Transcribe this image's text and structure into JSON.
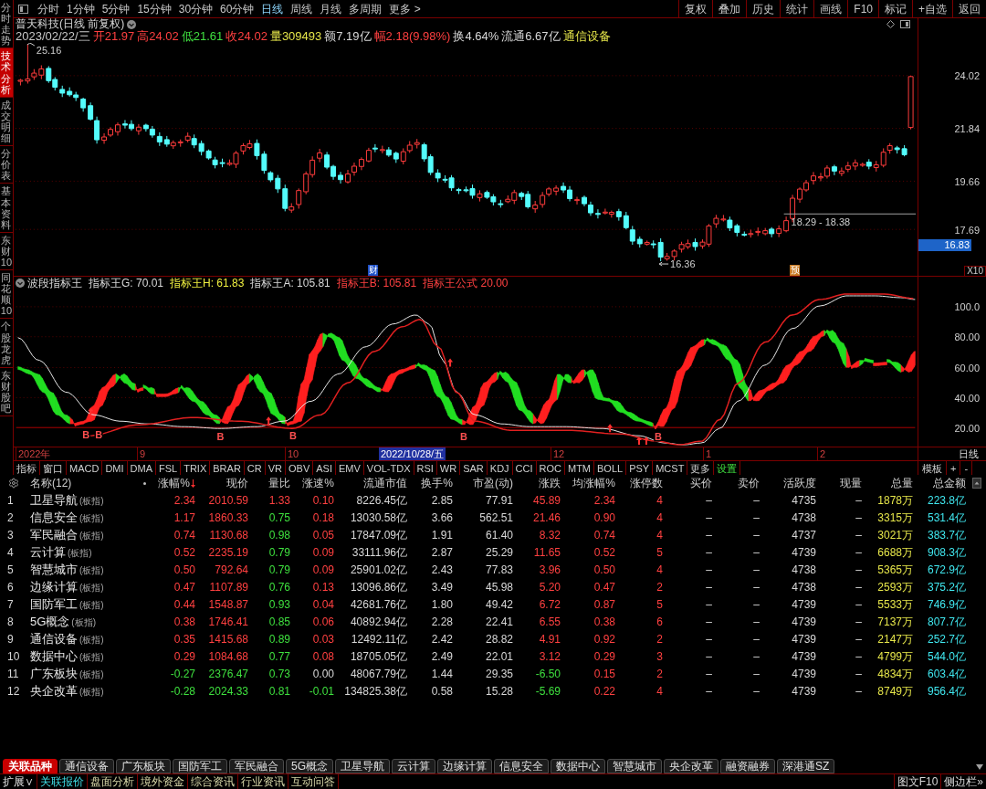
{
  "sidebar": {
    "tabs": [
      {
        "label": "分时走势",
        "selected": false
      },
      {
        "label": "技术分析",
        "selected": true
      },
      {
        "label": "成交明细",
        "selected": false
      },
      {
        "label": "分价表",
        "selected": false
      },
      {
        "label": "基本资料",
        "selected": false
      },
      {
        "label": "东财10",
        "selected": false
      },
      {
        "label": "同花顺10",
        "selected": false
      },
      {
        "label": "个股龙虎",
        "selected": false
      },
      {
        "label": "东财股吧",
        "selected": false
      }
    ]
  },
  "toolbar": {
    "periods": [
      {
        "label": "分时",
        "selected": false
      },
      {
        "label": "1分钟",
        "selected": false
      },
      {
        "label": "5分钟",
        "selected": false
      },
      {
        "label": "15分钟",
        "selected": false
      },
      {
        "label": "30分钟",
        "selected": false
      },
      {
        "label": "60分钟",
        "selected": false
      },
      {
        "label": "日线",
        "selected": true
      },
      {
        "label": "周线",
        "selected": false
      },
      {
        "label": "月线",
        "selected": false
      },
      {
        "label": "多周期",
        "selected": false
      },
      {
        "label": "更多 >",
        "selected": false
      }
    ],
    "actions": [
      "复权",
      "叠加",
      "历史",
      "统计",
      "画线",
      "F10",
      "标记",
      "+自选",
      "返回"
    ]
  },
  "price_chart": {
    "title": "普天科技(日线 前复权)",
    "date": "2023/02/22/三",
    "quote": [
      {
        "text": "开21.97",
        "color": "#ff4040"
      },
      {
        "text": "高24.02",
        "color": "#ff4040"
      },
      {
        "text": "低21.61",
        "color": "#40e040"
      },
      {
        "text": "收24.02",
        "color": "#ff4040"
      },
      {
        "text": "量309493",
        "color": "#e6e64a"
      },
      {
        "text": "额7.19亿",
        "color": "#d8d8d8"
      },
      {
        "text": "幅2.18(9.98%)",
        "color": "#ff4040"
      },
      {
        "text": "换4.64%",
        "color": "#d8d8d8"
      },
      {
        "text": "流通6.67亿",
        "color": "#d8d8d8"
      },
      {
        "text": "通信设备",
        "color": "#e6e64a"
      }
    ],
    "axis_labels": [
      "24.02",
      "21.84",
      "19.66",
      "17.69"
    ],
    "marker_price": "16.83",
    "scale": "X10",
    "high_label": "25.16",
    "low_label": "16.36",
    "range_label": "18.29 - 18.38",
    "events": [
      {
        "label": "财",
        "kind": "finance"
      },
      {
        "label": "预",
        "kind": "forecast"
      }
    ]
  },
  "indicator": {
    "name": "波段指标王",
    "values": [
      {
        "text": "指标王G: 70.01",
        "color": "#d8d8d8"
      },
      {
        "text": "指标王H: 61.83",
        "color": "#f0f040"
      },
      {
        "text": "指标王A: 105.81",
        "color": "#d8d8d8"
      },
      {
        "text": "指标王B: 105.81",
        "color": "#ff4040"
      },
      {
        "text": "指标王公式 20.00",
        "color": "#ff4040"
      }
    ],
    "axis_labels": [
      "100.0",
      "80.00",
      "60.00",
      "40.00",
      "20.00"
    ],
    "signals": [
      "B",
      "B",
      "B",
      "B",
      "B",
      "B"
    ]
  },
  "date_axis": {
    "ticks": [
      "2022年",
      "9",
      "10",
      "12",
      "1",
      "2"
    ],
    "cursor_date": "2022/10/28/五",
    "period": "日线"
  },
  "indicator_bar": {
    "items": [
      "指标",
      "窗口",
      "MACD",
      "DMI",
      "DMA",
      "FSL",
      "TRIX",
      "BRAR",
      "CR",
      "VR",
      "OBV",
      "ASI",
      "EMV",
      "VOL-TDX",
      "RSI",
      "WR",
      "SAR",
      "KDJ",
      "CCI",
      "ROC",
      "MTM",
      "BOLL",
      "PSY",
      "MCST",
      "更多"
    ],
    "settings": "设置",
    "tools": [
      "模板",
      "+",
      "-"
    ]
  },
  "table": {
    "name_header": "名称(12)",
    "columns": [
      {
        "label": "涨幅%",
        "sorted": true
      },
      {
        "label": "现价",
        "sorted": false
      },
      {
        "label": "量比",
        "sorted": false
      },
      {
        "label": "涨速%",
        "sorted": false
      },
      {
        "label": "流通市值",
        "sorted": false
      },
      {
        "label": "换手%",
        "sorted": false
      },
      {
        "label": "市盈(动)",
        "sorted": false
      },
      {
        "label": "涨跌",
        "sorted": false
      },
      {
        "label": "均涨幅%",
        "sorted": false
      },
      {
        "label": "涨停数",
        "sorted": false
      },
      {
        "label": "买价",
        "sorted": false
      },
      {
        "label": "卖价",
        "sorted": false
      },
      {
        "label": "活跃度",
        "sorted": false
      },
      {
        "label": "现量",
        "sorted": false
      },
      {
        "label": "总量",
        "sorted": false
      },
      {
        "label": "总金额",
        "sorted": false
      }
    ],
    "rows": [
      {
        "no": "1",
        "name": "卫星导航",
        "tag": "(板指)",
        "rising": true,
        "vol_ratio_high": true,
        "speed_rising": true,
        "speed_falling": false,
        "cells": [
          "2.34",
          "2010.59",
          "1.33",
          "0.10",
          "8226.45亿",
          "2.85",
          "77.91",
          "45.89",
          "2.34",
          "4",
          "–",
          "–",
          "4735",
          "–",
          "1878万",
          "223.8亿"
        ]
      },
      {
        "no": "2",
        "name": "信息安全",
        "tag": "(板指)",
        "rising": true,
        "vol_ratio_high": false,
        "speed_rising": true,
        "speed_falling": false,
        "cells": [
          "1.17",
          "1860.33",
          "0.75",
          "0.18",
          "13030.58亿",
          "3.66",
          "562.51",
          "21.46",
          "0.90",
          "4",
          "–",
          "–",
          "4738",
          "–",
          "3315万",
          "531.4亿"
        ]
      },
      {
        "no": "3",
        "name": "军民融合",
        "tag": "(板指)",
        "rising": true,
        "vol_ratio_high": false,
        "speed_rising": true,
        "speed_falling": false,
        "cells": [
          "0.74",
          "1130.68",
          "0.98",
          "0.05",
          "17847.09亿",
          "1.91",
          "61.40",
          "8.32",
          "0.74",
          "4",
          "–",
          "–",
          "4737",
          "–",
          "3021万",
          "383.7亿"
        ]
      },
      {
        "no": "4",
        "name": "云计算",
        "tag": "(板指)",
        "rising": true,
        "vol_ratio_high": false,
        "speed_rising": true,
        "speed_falling": false,
        "cells": [
          "0.52",
          "2235.19",
          "0.79",
          "0.09",
          "33111.96亿",
          "2.87",
          "25.29",
          "11.65",
          "0.52",
          "5",
          "–",
          "–",
          "4739",
          "–",
          "6688万",
          "908.3亿"
        ]
      },
      {
        "no": "5",
        "name": "智慧城市",
        "tag": "(板指)",
        "rising": true,
        "vol_ratio_high": false,
        "speed_rising": true,
        "speed_falling": false,
        "cells": [
          "0.50",
          "792.64",
          "0.79",
          "0.09",
          "25901.02亿",
          "2.43",
          "77.83",
          "3.96",
          "0.50",
          "4",
          "–",
          "–",
          "4738",
          "–",
          "5365万",
          "672.9亿"
        ]
      },
      {
        "no": "6",
        "name": "边缘计算",
        "tag": "(板指)",
        "rising": true,
        "vol_ratio_high": false,
        "speed_rising": true,
        "speed_falling": false,
        "cells": [
          "0.47",
          "1107.89",
          "0.76",
          "0.13",
          "13096.86亿",
          "3.49",
          "45.98",
          "5.20",
          "0.47",
          "2",
          "–",
          "–",
          "4738",
          "–",
          "2593万",
          "375.2亿"
        ]
      },
      {
        "no": "7",
        "name": "国防军工",
        "tag": "(板指)",
        "rising": true,
        "vol_ratio_high": false,
        "speed_rising": true,
        "speed_falling": false,
        "cells": [
          "0.44",
          "1548.87",
          "0.93",
          "0.04",
          "42681.76亿",
          "1.80",
          "49.42",
          "6.72",
          "0.87",
          "5",
          "–",
          "–",
          "4739",
          "–",
          "5533万",
          "746.9亿"
        ]
      },
      {
        "no": "8",
        "name": "5G概念",
        "tag": "(板指)",
        "rising": true,
        "vol_ratio_high": false,
        "speed_rising": true,
        "speed_falling": false,
        "cells": [
          "0.38",
          "1746.41",
          "0.85",
          "0.06",
          "40892.94亿",
          "2.28",
          "22.41",
          "6.55",
          "0.38",
          "6",
          "–",
          "–",
          "4739",
          "–",
          "7137万",
          "807.7亿"
        ]
      },
      {
        "no": "9",
        "name": "通信设备",
        "tag": "(板指)",
        "rising": true,
        "vol_ratio_high": false,
        "speed_rising": true,
        "speed_falling": false,
        "cells": [
          "0.35",
          "1415.68",
          "0.89",
          "0.03",
          "12492.11亿",
          "2.42",
          "28.82",
          "4.91",
          "0.92",
          "2",
          "–",
          "–",
          "4739",
          "–",
          "2147万",
          "252.7亿"
        ]
      },
      {
        "no": "10",
        "name": "数据中心",
        "tag": "(板指)",
        "rising": true,
        "vol_ratio_high": false,
        "speed_rising": true,
        "speed_falling": false,
        "cells": [
          "0.29",
          "1084.68",
          "0.77",
          "0.08",
          "18705.05亿",
          "2.49",
          "22.01",
          "3.12",
          "0.29",
          "3",
          "–",
          "–",
          "4739",
          "–",
          "4799万",
          "544.0亿"
        ]
      },
      {
        "no": "11",
        "name": "广东板块",
        "tag": "(板指)",
        "rising": false,
        "vol_ratio_high": false,
        "speed_rising": false,
        "speed_falling": false,
        "cells": [
          "-0.27",
          "2376.47",
          "0.73",
          "0.00",
          "48067.79亿",
          "1.44",
          "29.35",
          "-6.50",
          "0.15",
          "2",
          "–",
          "–",
          "4739",
          "–",
          "4834万",
          "603.4亿"
        ]
      },
      {
        "no": "12",
        "name": "央企改革",
        "tag": "(板指)",
        "rising": false,
        "vol_ratio_high": false,
        "speed_rising": false,
        "speed_falling": true,
        "cells": [
          "-0.28",
          "2024.33",
          "0.81",
          "-0.01",
          "134825.38亿",
          "0.58",
          "15.28",
          "-5.69",
          "0.22",
          "4",
          "–",
          "–",
          "4739",
          "–",
          "8749万",
          "956.4亿"
        ]
      }
    ]
  },
  "bottom_tabs": [
    {
      "label": "关联品种",
      "selected": true
    },
    {
      "label": "通信设备",
      "selected": false
    },
    {
      "label": "广东板块",
      "selected": false
    },
    {
      "label": "国防军工",
      "selected": false
    },
    {
      "label": "军民融合",
      "selected": false
    },
    {
      "label": "5G概念",
      "selected": false
    },
    {
      "label": "卫星导航",
      "selected": false
    },
    {
      "label": "云计算",
      "selected": false
    },
    {
      "label": "边缘计算",
      "selected": false
    },
    {
      "label": "信息安全",
      "selected": false
    },
    {
      "label": "数据中心",
      "selected": false
    },
    {
      "label": "智慧城市",
      "selected": false
    },
    {
      "label": "央企改革",
      "selected": false
    },
    {
      "label": "融资融券",
      "selected": false
    },
    {
      "label": "深港通SZ",
      "selected": false
    }
  ],
  "bottom_bar": {
    "expand": "扩展∨",
    "links": [
      {
        "label": "关联报价",
        "selected": true
      },
      {
        "label": "盘面分析",
        "selected": false
      },
      {
        "label": "境外资金",
        "selected": false
      },
      {
        "label": "综合资讯",
        "selected": false
      },
      {
        "label": "行业资讯",
        "selected": false
      },
      {
        "label": "互动问答",
        "selected": false
      }
    ],
    "actions": [
      "图文F10",
      "侧边栏»"
    ]
  }
}
